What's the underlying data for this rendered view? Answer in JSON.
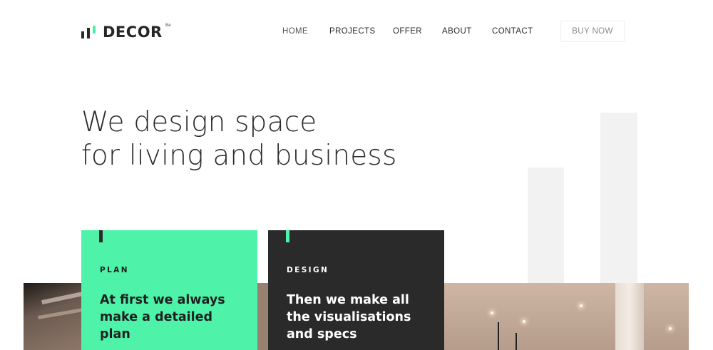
{
  "brand": {
    "name": "DECOR",
    "superscript": "Be",
    "icon": "bar-chart-logo-icon",
    "accent_color": "#4ef3a9"
  },
  "nav": {
    "items": [
      "HOME",
      "PROJECTS",
      "OFFER",
      "ABOUT",
      "CONTACT"
    ],
    "cta": "BUY NOW"
  },
  "hero": {
    "line1": "We design space",
    "line2": "for living and business"
  },
  "cards": [
    {
      "label": "PLAN",
      "text": "At first we always make a detailed plan",
      "background": "#4ef3a9"
    },
    {
      "label": "DESIGN",
      "text": "Then we make all the visualisations and specs",
      "background": "#2a2a2a"
    }
  ]
}
